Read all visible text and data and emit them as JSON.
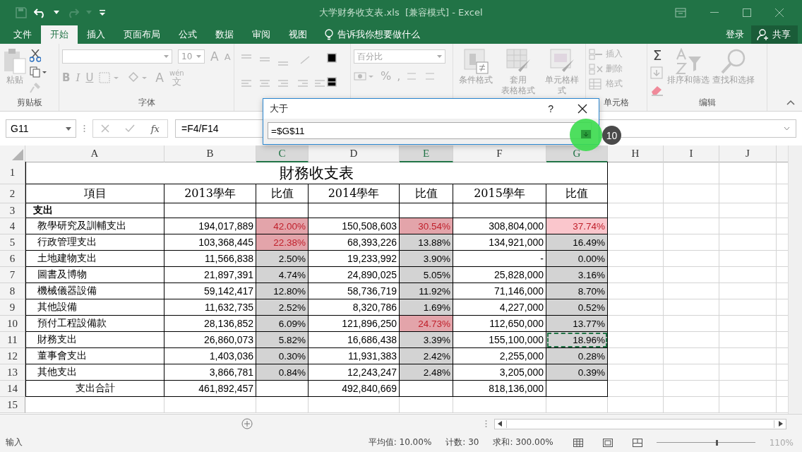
{
  "title_bar": {
    "title": "大学财务收支表.xls  [兼容模式] - Excel"
  },
  "menu_tabs": [
    {
      "label": "文件",
      "selected": false
    },
    {
      "label": "开始",
      "selected": true
    },
    {
      "label": "插入",
      "selected": false
    },
    {
      "label": "页面布局",
      "selected": false
    },
    {
      "label": "公式",
      "selected": false
    },
    {
      "label": "数据",
      "selected": false
    },
    {
      "label": "审阅",
      "selected": false
    },
    {
      "label": "视图",
      "selected": false
    }
  ],
  "tell_me": "告诉我你想要做什么",
  "sign_in": "登录",
  "share": "共享",
  "ribbon": {
    "paste": "粘贴",
    "clipboard_group": "剪贴板",
    "font_size": "10",
    "grow_font": "A",
    "shrink_font": "A",
    "bold": "B",
    "italic": "I",
    "underline": "U",
    "font_color": "A",
    "phonetic_top": "wén",
    "phonetic_bottom": "文",
    "font_group": "字体",
    "number_format": "百分比",
    "percent": "%",
    "comma": ",",
    "conditional_format": "条件格式",
    "table_format_top": "套用",
    "table_format_bottom": "表格格式",
    "cell_styles": "单元格样式",
    "insert": "插入",
    "delete": "删除",
    "format": "格式",
    "cells_group": "单元格",
    "autosum": "Σ",
    "sort_filter": "排序和筛选",
    "find_select": "查找和选择",
    "editing_group": "编辑"
  },
  "formula_bar": {
    "name_box": "G11",
    "function_label": "fx",
    "formula": "=F4/F14"
  },
  "columns": [
    {
      "label": "A",
      "selected": false
    },
    {
      "label": "B",
      "selected": false
    },
    {
      "label": "C",
      "selected": true
    },
    {
      "label": "D",
      "selected": false
    },
    {
      "label": "E",
      "selected": true
    },
    {
      "label": "F",
      "selected": false
    },
    {
      "label": "G",
      "selected": true
    },
    {
      "label": "H",
      "selected": false
    },
    {
      "label": "I",
      "selected": false
    },
    {
      "label": "J",
      "selected": false
    }
  ],
  "rows": [
    {
      "n": "1",
      "kind": "title",
      "title": "財務收支表"
    },
    {
      "n": "2",
      "kind": "header",
      "cells": [
        "項目",
        "2013學年",
        "比值",
        "2014學年",
        "比值",
        "2015學年",
        "比值"
      ]
    },
    {
      "n": "3",
      "kind": "section",
      "label": "支出"
    },
    {
      "n": "4",
      "kind": "item",
      "label": "教學研究及訓輔支出",
      "amounts": [
        "194,017,889",
        "150,508,603",
        "308,804,000"
      ],
      "ratios": [
        {
          "text": "42.00%",
          "highlight": true,
          "selected": true,
          "marquee": false
        },
        {
          "text": "30.54%",
          "highlight": true,
          "selected": true,
          "marquee": false
        },
        {
          "text": "37.74%",
          "highlight": true,
          "selected": false,
          "marquee": false
        }
      ]
    },
    {
      "n": "5",
      "kind": "item",
      "label": "行政管理支出",
      "amounts": [
        "103,368,445",
        "68,393,226",
        "134,921,000"
      ],
      "ratios": [
        {
          "text": "22.38%",
          "highlight": true,
          "selected": true,
          "marquee": false
        },
        {
          "text": "13.88%",
          "highlight": false,
          "selected": true,
          "marquee": false
        },
        {
          "text": "16.49%",
          "highlight": false,
          "selected": true,
          "marquee": false
        }
      ]
    },
    {
      "n": "6",
      "kind": "item",
      "label": "土地建物支出",
      "amounts": [
        "11,566,838",
        "19,233,992",
        "-"
      ],
      "ratios": [
        {
          "text": "2.50%",
          "highlight": false,
          "selected": true,
          "marquee": false
        },
        {
          "text": "3.90%",
          "highlight": false,
          "selected": true,
          "marquee": false
        },
        {
          "text": "0.00%",
          "highlight": false,
          "selected": true,
          "marquee": false
        }
      ]
    },
    {
      "n": "7",
      "kind": "item",
      "label": "圖書及博物",
      "amounts": [
        "21,897,391",
        "24,890,025",
        "25,828,000"
      ],
      "ratios": [
        {
          "text": "4.74%",
          "highlight": false,
          "selected": true,
          "marquee": false
        },
        {
          "text": "5.05%",
          "highlight": false,
          "selected": true,
          "marquee": false
        },
        {
          "text": "3.16%",
          "highlight": false,
          "selected": true,
          "marquee": false
        }
      ]
    },
    {
      "n": "8",
      "kind": "item",
      "label": "機械儀器設備",
      "amounts": [
        "59,142,417",
        "58,736,719",
        "71,146,000"
      ],
      "ratios": [
        {
          "text": "12.80%",
          "highlight": false,
          "selected": true,
          "marquee": false
        },
        {
          "text": "11.92%",
          "highlight": false,
          "selected": true,
          "marquee": false
        },
        {
          "text": "8.70%",
          "highlight": false,
          "selected": true,
          "marquee": false
        }
      ]
    },
    {
      "n": "9",
      "kind": "item",
      "label": "其他設備",
      "amounts": [
        "11,632,735",
        "8,320,786",
        "4,227,000"
      ],
      "ratios": [
        {
          "text": "2.52%",
          "highlight": false,
          "selected": true,
          "marquee": false
        },
        {
          "text": "1.69%",
          "highlight": false,
          "selected": true,
          "marquee": false
        },
        {
          "text": "0.52%",
          "highlight": false,
          "selected": true,
          "marquee": false
        }
      ]
    },
    {
      "n": "10",
      "kind": "item",
      "label": "預付工程設備款",
      "amounts": [
        "28,136,852",
        "121,896,250",
        "112,650,000"
      ],
      "ratios": [
        {
          "text": "6.09%",
          "highlight": false,
          "selected": true,
          "marquee": false
        },
        {
          "text": "24.73%",
          "highlight": true,
          "selected": true,
          "marquee": false
        },
        {
          "text": "13.77%",
          "highlight": false,
          "selected": true,
          "marquee": false
        }
      ]
    },
    {
      "n": "11",
      "kind": "item",
      "label": "財務支出",
      "amounts": [
        "26,860,073",
        "16,686,438",
        "155,100,000"
      ],
      "ratios": [
        {
          "text": "5.82%",
          "highlight": false,
          "selected": true,
          "marquee": false
        },
        {
          "text": "3.39%",
          "highlight": false,
          "selected": true,
          "marquee": false
        },
        {
          "text": "18.96%",
          "highlight": false,
          "selected": true,
          "marquee": true
        }
      ]
    },
    {
      "n": "12",
      "kind": "item",
      "label": "董事會支出",
      "amounts": [
        "1,403,036",
        "11,931,383",
        "2,255,000"
      ],
      "ratios": [
        {
          "text": "0.30%",
          "highlight": false,
          "selected": true,
          "marquee": false
        },
        {
          "text": "2.42%",
          "highlight": false,
          "selected": true,
          "marquee": false
        },
        {
          "text": "0.28%",
          "highlight": false,
          "selected": true,
          "marquee": false
        }
      ]
    },
    {
      "n": "13",
      "kind": "item",
      "label": "其他支出",
      "amounts": [
        "3,866,781",
        "12,243,247",
        "3,205,000"
      ],
      "ratios": [
        {
          "text": "0.84%",
          "highlight": false,
          "selected": true,
          "marquee": false
        },
        {
          "text": "2.48%",
          "highlight": false,
          "selected": true,
          "marquee": false
        },
        {
          "text": "0.39%",
          "highlight": false,
          "selected": true,
          "marquee": false
        }
      ]
    },
    {
      "n": "14",
      "kind": "total",
      "label": "支出合計",
      "amounts": [
        "461,892,457",
        "492,840,669",
        "818,136,000"
      ]
    },
    {
      "n": "15",
      "kind": "empty"
    }
  ],
  "dialog": {
    "title": "大于",
    "help": "?",
    "value": "=$G$11",
    "step_badge": "10"
  },
  "status_bar": {
    "mode": "输入",
    "average": "平均值: 10.00%",
    "count": "计数: 30",
    "sum": "求和: 300.00%",
    "zoom": "110%",
    "zoom_slider": {
      "level": 0.6
    }
  }
}
